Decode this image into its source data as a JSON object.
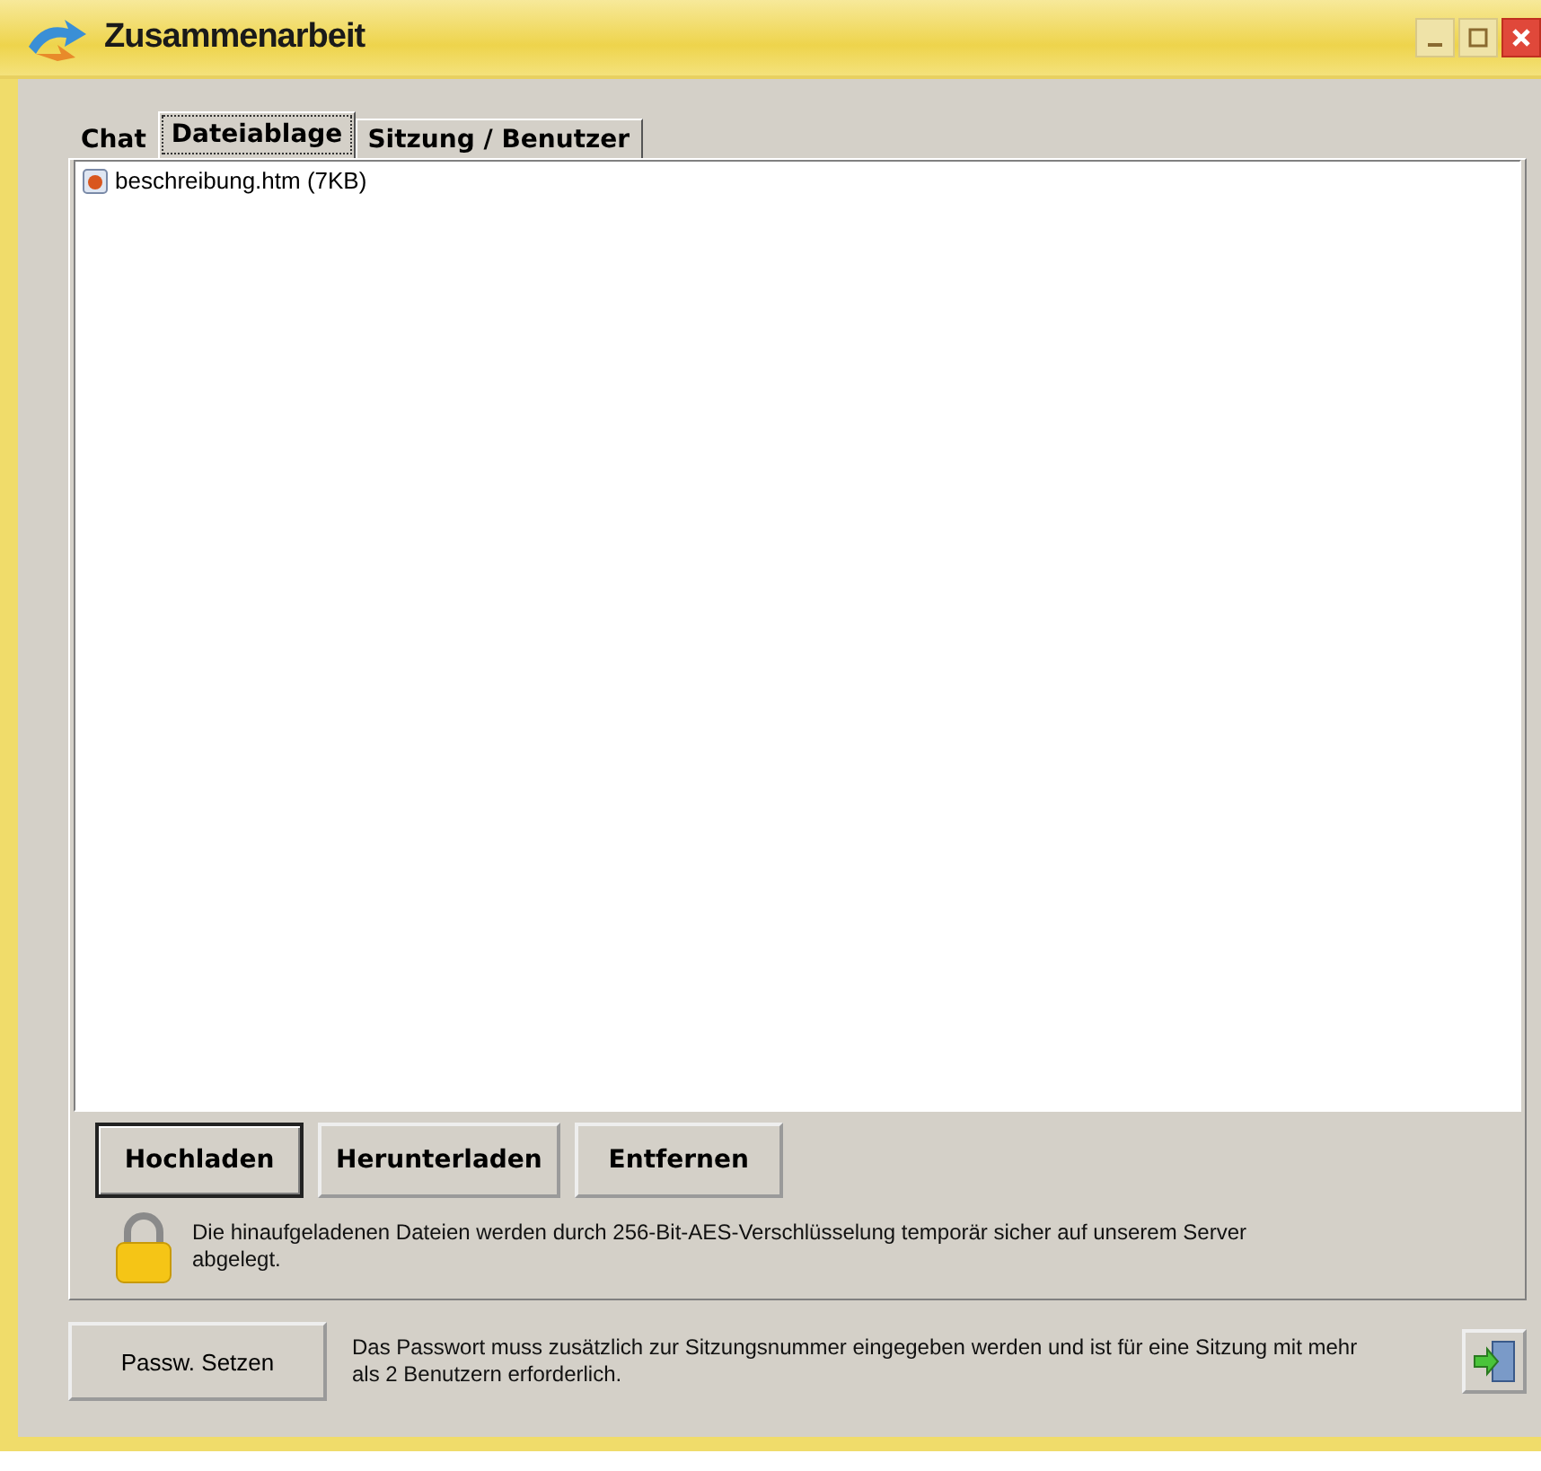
{
  "window": {
    "title": "Zusammenarbeit"
  },
  "tabs": [
    {
      "label": "Chat",
      "selected": false
    },
    {
      "label": "Dateiablage",
      "selected": true
    },
    {
      "label": "Sitzung / Benutzer",
      "selected": false
    }
  ],
  "files": [
    {
      "name": "beschreibung.htm (7KB)"
    }
  ],
  "buttons": [
    {
      "label": "Hochladen",
      "default": true
    },
    {
      "label": "Herunterladen",
      "default": false
    },
    {
      "label": "Entfernen",
      "default": false
    }
  ],
  "security_note": "Die hinaufgeladenen Dateien werden durch 256-Bit-AES-Verschlüsselung temporär sicher auf unserem Server abgelegt.",
  "password_button": "Passw. Setzen",
  "password_note": "Das Passwort muss zusätzlich zur Sitzungsnummer eingegeben werden und ist für eine Sitzung mit mehr als 2 Benutzern erforderlich."
}
